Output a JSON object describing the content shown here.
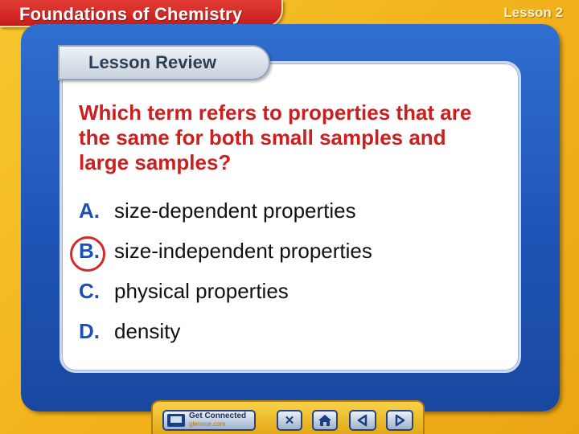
{
  "header": {
    "title": "Foundations of Chemistry",
    "lesson_tag": "Lesson 2"
  },
  "section": {
    "label": "Lesson Review"
  },
  "question": {
    "text": "Which term refers to properties that are the same for both small samples and large samples?"
  },
  "answers": [
    {
      "letter": "A.",
      "text": "size-dependent properties"
    },
    {
      "letter": "B.",
      "text": "size-independent properties",
      "selected": true
    },
    {
      "letter": "C.",
      "text": "physical properties"
    },
    {
      "letter": "D.",
      "text": "density"
    }
  ],
  "nav": {
    "connect_label": "Get Connected",
    "connect_sub": "glencoe.com",
    "icons": [
      "monitor-icon",
      "close-icon",
      "home-icon",
      "previous-icon",
      "next-icon"
    ]
  },
  "colors": {
    "question_text": "#cc1f1f",
    "answer_letter": "#1f4fb3",
    "selection_ring": "#d42a2a",
    "frame_blue": "#1d52b3",
    "background_yellow": "#f2b11a",
    "title_red": "#c81c1c"
  }
}
